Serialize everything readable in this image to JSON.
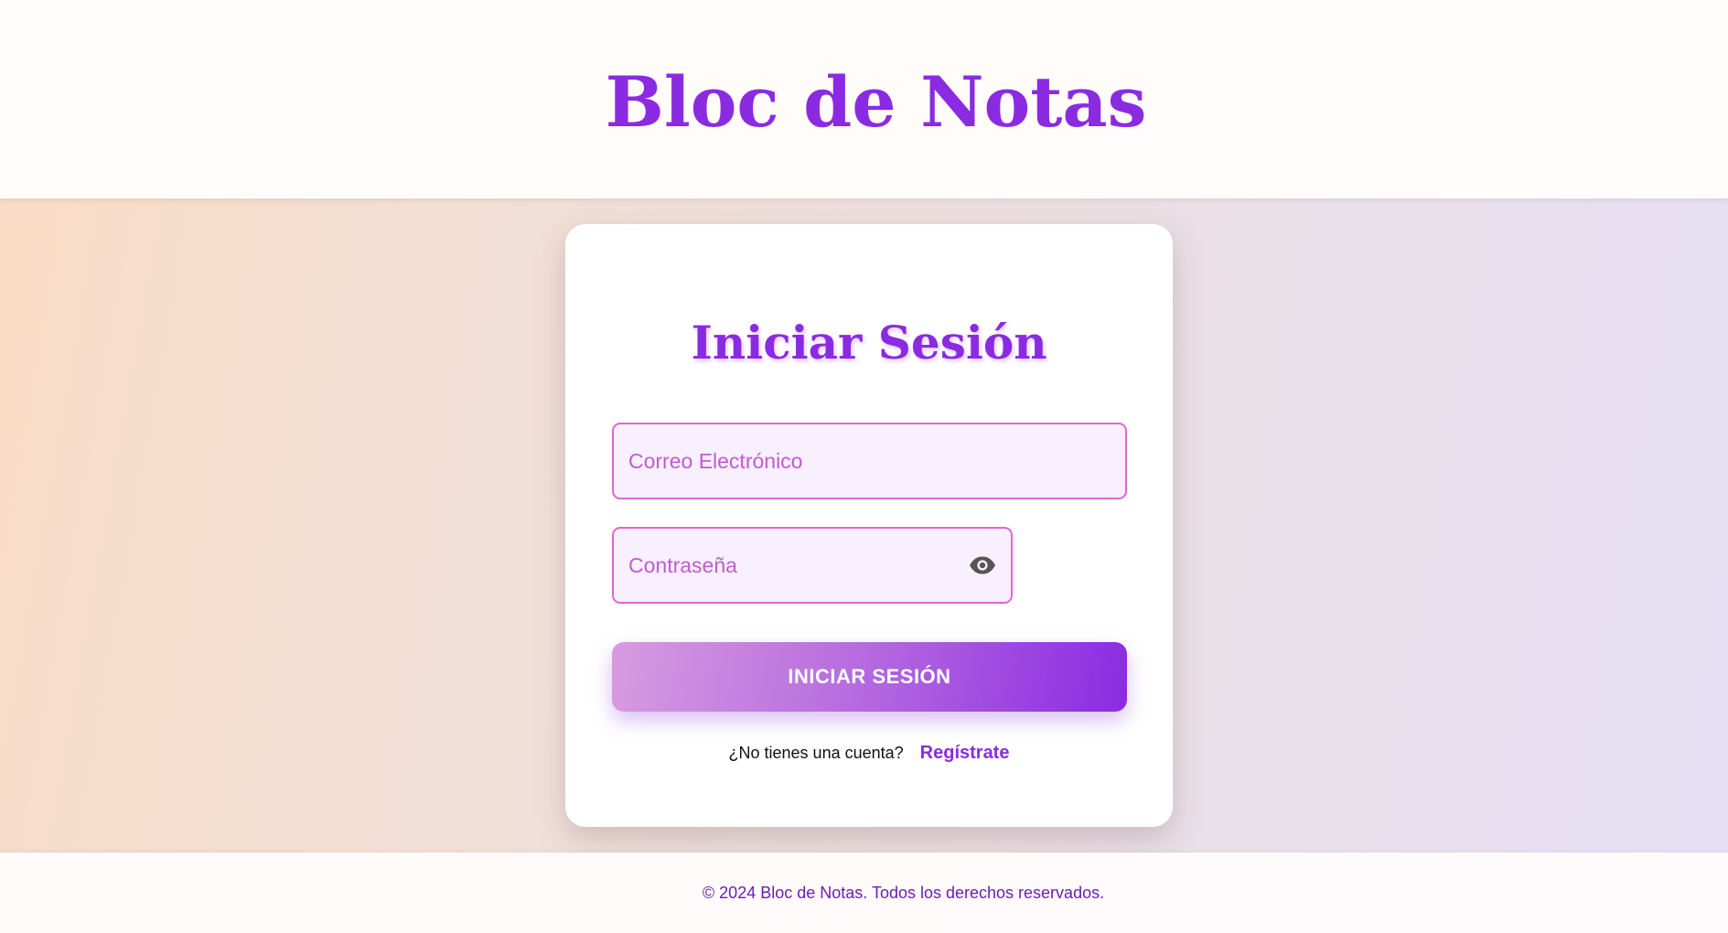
{
  "header": {
    "title": "Bloc de Notas"
  },
  "login": {
    "title": "Iniciar Sesión",
    "email_placeholder": "Correo Electrónico",
    "password_placeholder": "Contraseña",
    "password_toggle_icon": "eye-icon",
    "submit_label": "INICIAR SESIÓN",
    "register_question": "¿No tienes una cuenta?",
    "register_link": "Regístrate"
  },
  "footer": {
    "text": "© 2024 Bloc de Notas. Todos los derechos reservados."
  },
  "colors": {
    "accent": "#8a2be2",
    "field_border": "#e066d4",
    "field_background": "#f8efff",
    "placeholder": "#c05ccf",
    "button_gradient_start": "#d89be0",
    "button_gradient_end": "#8a2be2",
    "footer_text": "#6a1fb0"
  }
}
